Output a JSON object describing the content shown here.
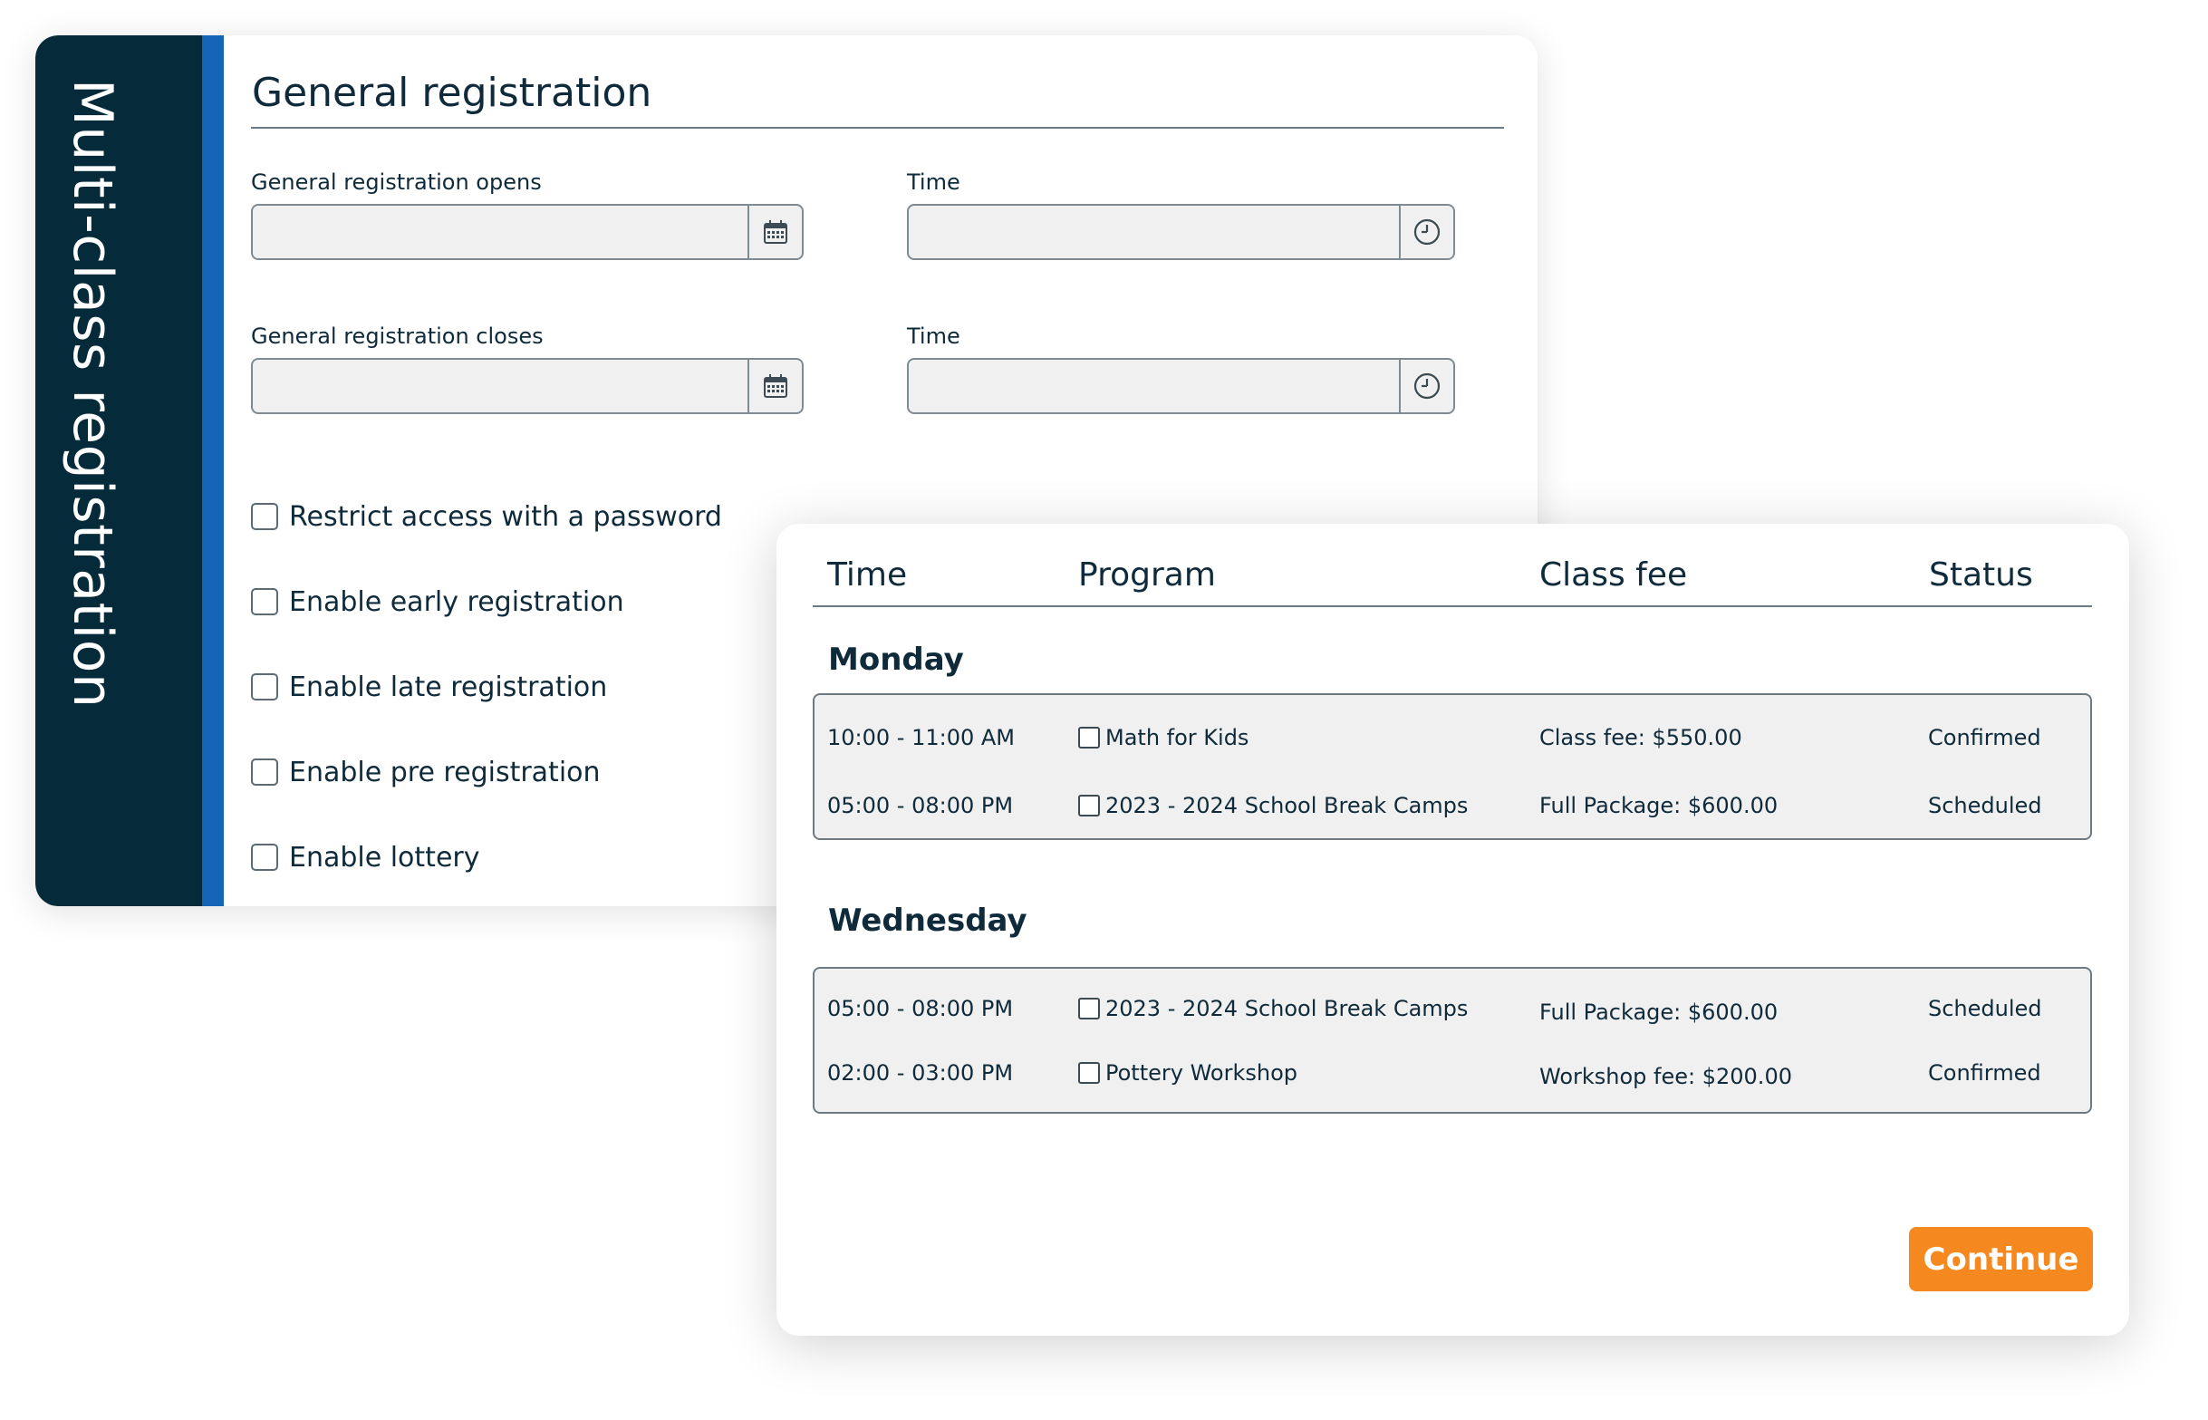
{
  "sidebar": {
    "title": "Multi-class registration"
  },
  "general": {
    "title": "General registration",
    "opens_label": "General registration opens",
    "closes_label": "General registration closes",
    "time_label": "Time",
    "opens_date_value": "",
    "opens_time_value": "",
    "closes_date_value": "",
    "closes_time_value": "",
    "options": [
      {
        "label": "Restrict access with a password",
        "checked": false
      },
      {
        "label": "Enable early registration",
        "checked": false
      },
      {
        "label": "Enable late registration",
        "checked": false
      },
      {
        "label": "Enable pre registration",
        "checked": false
      },
      {
        "label": "Enable lottery",
        "checked": false
      }
    ]
  },
  "schedule": {
    "headers": {
      "time": "Time",
      "program": "Program",
      "class_fee": "Class fee",
      "status": "Status"
    },
    "days": [
      {
        "name": "Monday",
        "rows": [
          {
            "time": "10:00 - 11:00 AM",
            "program": "Math for Kids",
            "fee": "Class fee: $550.00",
            "status": "Confirmed"
          },
          {
            "time": "05:00 - 08:00 PM",
            "program": "2023 - 2024 School Break Camps",
            "fee": "Full Package: $600.00",
            "status": "Scheduled"
          }
        ]
      },
      {
        "name": "Wednesday",
        "rows": [
          {
            "time": "05:00 - 08:00 PM",
            "program": "2023 - 2024 School Break Camps",
            "fee": "Full Package: $600.00",
            "status": "Scheduled"
          },
          {
            "time": "02:00 - 03:00 PM",
            "program": "Pottery Workshop",
            "fee": "Workshop fee: $200.00",
            "status": "Confirmed"
          }
        ]
      }
    ],
    "continue_label": "Continue"
  },
  "colors": {
    "sidebar_bg": "#052a3a",
    "sidebar_stripe": "#1464b8",
    "accent_button": "#f5891f",
    "input_bg": "#f0f0f0"
  },
  "icons": {
    "date": "calendar-icon",
    "time": "clock-icon"
  }
}
